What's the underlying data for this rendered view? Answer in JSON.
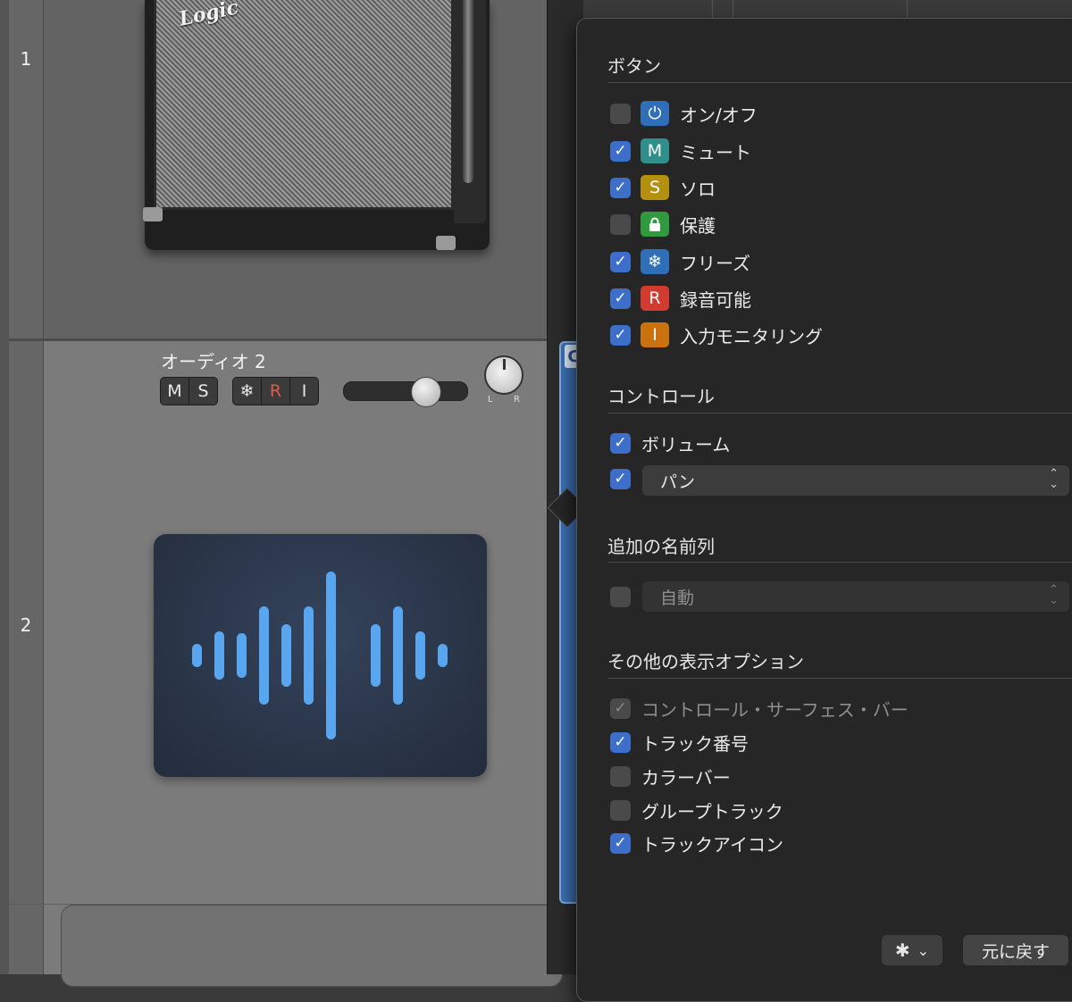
{
  "tracks": {
    "track1_number": "1",
    "track2_number": "2",
    "amp_logo": "Logic",
    "track2_name": "オーディオ 2",
    "buttons": {
      "mute": "M",
      "solo": "S",
      "freeze": "❄",
      "record": "R",
      "input": "I"
    },
    "pan_left": "L",
    "pan_right": "R",
    "volume_level": 0.72
  },
  "popover": {
    "buttons_section": {
      "title": "ボタン",
      "items": [
        {
          "label": "オン/オフ",
          "checked": false,
          "badge": "⏻",
          "badge_color": "#2f6fb8"
        },
        {
          "label": "ミュート",
          "checked": true,
          "badge": "M",
          "badge_color": "#2f8f8a"
        },
        {
          "label": "ソロ",
          "checked": true,
          "badge": "S",
          "badge_color": "#b59010"
        },
        {
          "label": "保護",
          "checked": false,
          "badge": "🔒",
          "badge_color": "#2f9a3e"
        },
        {
          "label": "フリーズ",
          "checked": true,
          "badge": "❄",
          "badge_color": "#2f6fb8"
        },
        {
          "label": "録音可能",
          "checked": true,
          "badge": "R",
          "badge_color": "#d23b2e"
        },
        {
          "label": "入力モニタリング",
          "checked": true,
          "badge": "I",
          "badge_color": "#c9720f"
        }
      ]
    },
    "controls_section": {
      "title": "コントロール",
      "volume_label": "ボリューム",
      "volume_checked": true,
      "pan_checked": true,
      "pan_value": "パン"
    },
    "name_column_section": {
      "title": "追加の名前列",
      "checked": false,
      "value": "自動"
    },
    "display_section": {
      "title": "その他の表示オプション",
      "items": [
        {
          "label": "コントロール・サーフェス・バー",
          "checked": true,
          "disabled": true
        },
        {
          "label": "トラック番号",
          "checked": true,
          "disabled": false
        },
        {
          "label": "カラーバー",
          "checked": false,
          "disabled": false
        },
        {
          "label": "グループトラック",
          "checked": false,
          "disabled": false
        },
        {
          "label": "トラックアイコン",
          "checked": true,
          "disabled": false
        }
      ]
    },
    "footer": {
      "gear_icon": "✱",
      "chevron": "⌄",
      "revert_label": "元に戻す"
    }
  },
  "colors": {
    "checkbox_on": "#3d6ec9",
    "region_blue": "#3b6fb0",
    "waveform": "#58a6f0"
  }
}
